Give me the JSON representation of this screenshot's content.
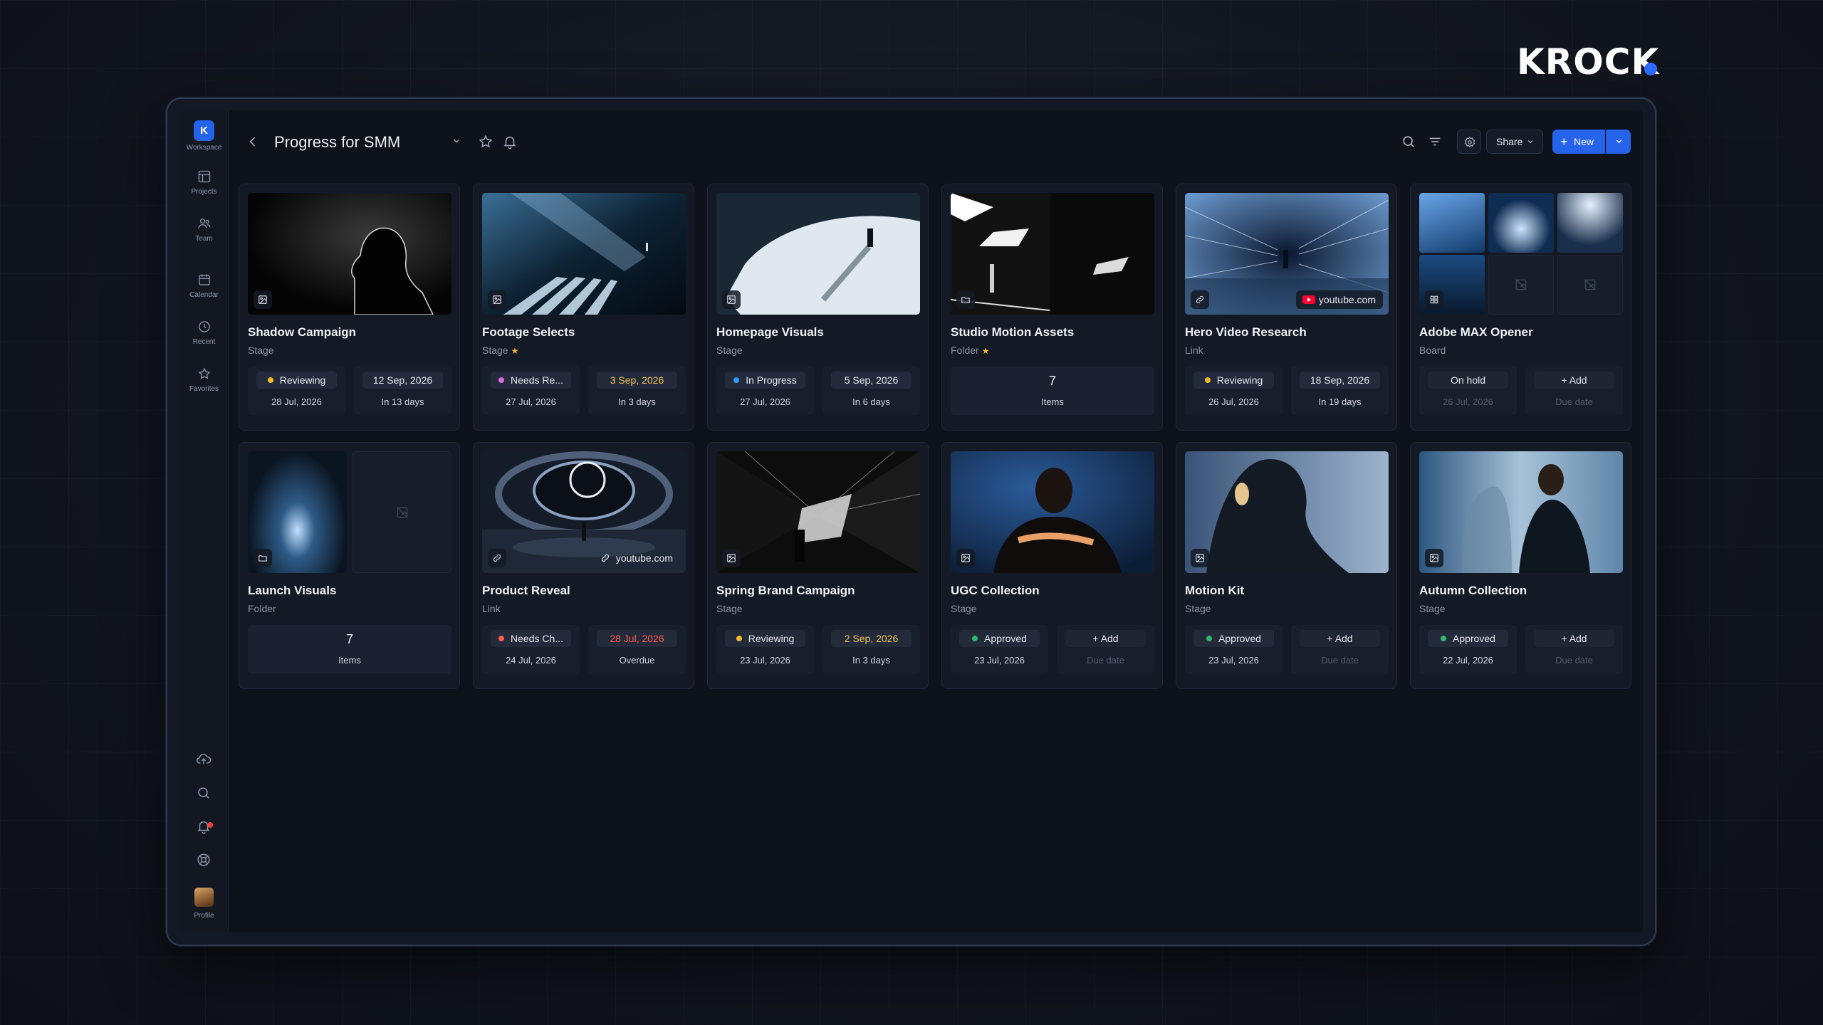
{
  "brand": {
    "name": "KROCK",
    "accent": "#2d6bff"
  },
  "sidebar": {
    "workspace_initial": "K",
    "workspace_label": "Workspace",
    "items": [
      {
        "label": "Projects",
        "icon": "layout-icon"
      },
      {
        "label": "Team",
        "icon": "users-icon"
      },
      {
        "label": "Calendar",
        "icon": "calendar-icon"
      },
      {
        "label": "Recent",
        "icon": "clock-icon"
      },
      {
        "label": "Favorites",
        "icon": "star-icon"
      }
    ],
    "bottom_icons": [
      "upload-icon",
      "search-icon",
      "bell-icon",
      "help-icon"
    ],
    "profile_label": "Profile"
  },
  "header": {
    "title": "Progress for SMM",
    "share_label": "Share",
    "new_label": "New"
  },
  "colors": {
    "primary": "#2563eb",
    "reviewing": "#f5b82e",
    "needs": "#d66be0",
    "in_progress": "#2f9bff",
    "approved": "#2fb86a",
    "overdue": "#ff5a4f"
  },
  "cards": [
    {
      "title": "Shadow Campaign",
      "type": "Stage",
      "starred": false,
      "status": "Reviewing",
      "status_color": "#f5b82e",
      "created": "28 Jul, 2026",
      "due": "12 Sep, 2026",
      "due_note": "In 13 days",
      "badge_icon": "image-icon"
    },
    {
      "title": "Footage Selects",
      "type": "Stage",
      "starred": true,
      "status": "Needs Re...",
      "status_color": "#d66be0",
      "created": "27 Jul, 2026",
      "due": "3 Sep, 2026",
      "due_note": "In 3 days",
      "due_tone": "warn",
      "badge_icon": "image-icon"
    },
    {
      "title": "Homepage Visuals",
      "type": "Stage",
      "starred": false,
      "status": "In Progress",
      "status_color": "#2f9bff",
      "created": "27 Jul, 2026",
      "due": "5 Sep, 2026",
      "due_note": "In 6 days",
      "badge_icon": "image-icon"
    },
    {
      "title": "Studio Motion Assets",
      "type": "Folder",
      "starred": true,
      "items_count": "7",
      "items_label": "Items",
      "badge_icon": "folder-icon"
    },
    {
      "title": "Hero Video Research",
      "type": "Link",
      "starred": false,
      "status": "Reviewing",
      "status_color": "#f5b82e",
      "created": "26 Jul, 2026",
      "due": "18 Sep, 2026",
      "due_note": "In 19 days",
      "badge_icon": "link-icon",
      "source": "youtube.com"
    },
    {
      "title": "Adobe MAX Opener",
      "type": "Board",
      "starred": false,
      "status": "On hold",
      "created": "26 Jul, 2026",
      "due": "Add",
      "due_note": "Due date",
      "badge_icon": "grid-icon"
    },
    {
      "title": "Launch Visuals",
      "type": "Folder",
      "starred": false,
      "items_count": "7",
      "items_label": "Items",
      "badge_icon": "folder-icon"
    },
    {
      "title": "Product Reveal",
      "type": "Link",
      "starred": false,
      "status": "Needs Ch...",
      "status_color": "#ff5a4f",
      "created": "24 Jul, 2026",
      "due": "28 Jul, 2026",
      "due_note": "Overdue",
      "due_tone": "danger",
      "badge_icon": "link-icon",
      "source": "youtube.com"
    },
    {
      "title": "Spring Brand Campaign",
      "type": "Stage",
      "starred": false,
      "status": "Reviewing",
      "status_color": "#f5b82e",
      "created": "23 Jul, 2026",
      "due": "2 Sep, 2026",
      "due_note": "In 3 days",
      "due_tone": "warn",
      "badge_icon": "image-icon"
    },
    {
      "title": "UGC Collection",
      "type": "Stage",
      "starred": false,
      "status": "Approved",
      "status_color": "#2fb86a",
      "created": "23 Jul, 2026",
      "due": "Add",
      "due_note": "Due date",
      "badge_icon": "image-icon"
    },
    {
      "title": "Motion Kit",
      "type": "Stage",
      "starred": false,
      "status": "Approved",
      "status_color": "#2fb86a",
      "created": "23 Jul, 2026",
      "due": "Add",
      "due_note": "Due date",
      "badge_icon": "image-icon"
    },
    {
      "title": "Autumn Collection",
      "type": "Stage",
      "starred": false,
      "status": "Approved",
      "status_color": "#2fb86a",
      "created": "22 Jul, 2026",
      "due": "Add",
      "due_note": "Due date",
      "badge_icon": "image-icon"
    }
  ]
}
